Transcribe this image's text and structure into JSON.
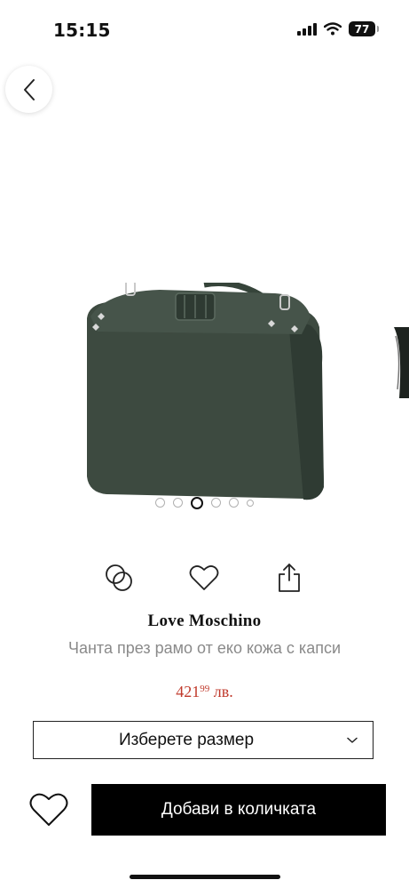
{
  "status_bar": {
    "time": "15:15",
    "battery": "77"
  },
  "gallery": {
    "dot_count": 6,
    "active_index": 2
  },
  "product": {
    "brand": "Love Moschino",
    "title": "Чанта през рамо от еко кожа с капси",
    "price_main": "421",
    "price_cents": "99",
    "price_currency": "лв."
  },
  "size_select": {
    "label": "Изберете размер"
  },
  "cart": {
    "add_label": "Добави в количката"
  },
  "colors": {
    "price": "#c0392b",
    "bag": "#3d4a40",
    "button": "#000000"
  },
  "icons": [
    "back-chevron-icon",
    "compare-icon",
    "heart-icon",
    "share-icon",
    "chevron-down-icon",
    "wishlist-heart-icon"
  ]
}
